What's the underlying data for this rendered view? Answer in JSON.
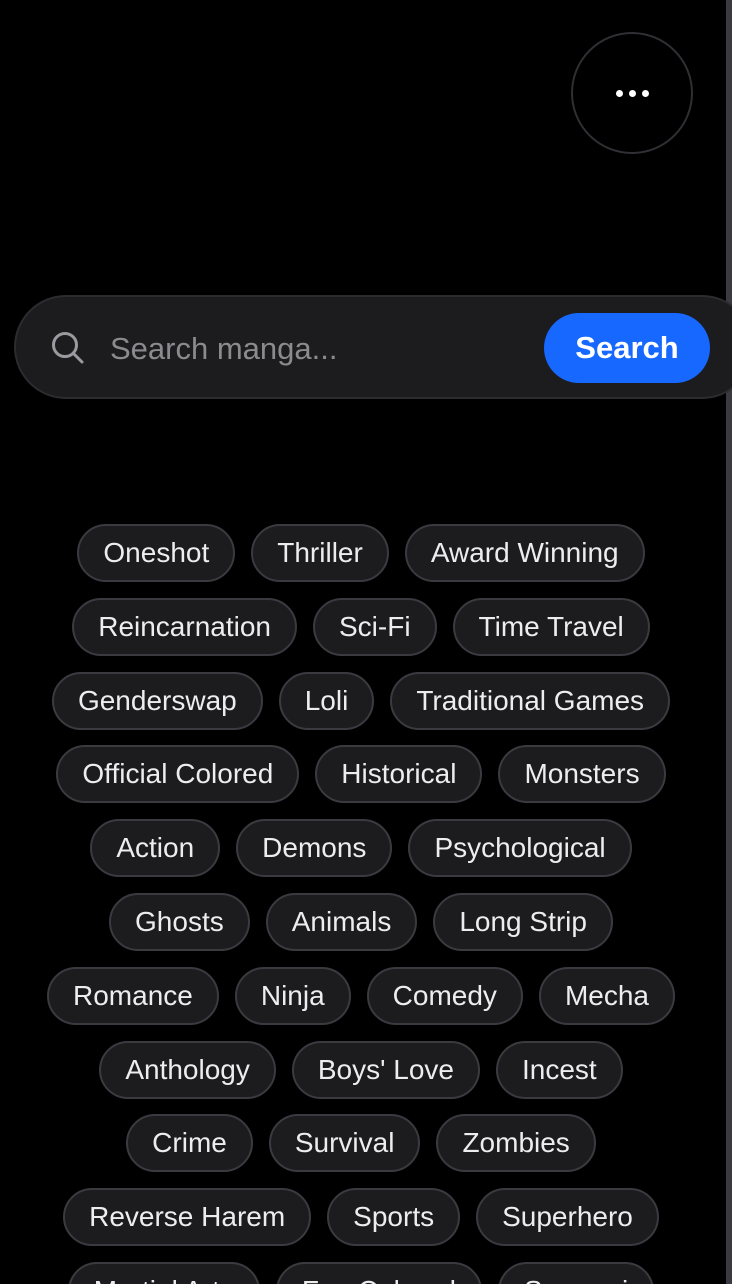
{
  "search": {
    "placeholder": "Search manga...",
    "button_label": "Search"
  },
  "tags": [
    [
      "Oneshot",
      "Thriller",
      "Award Winning"
    ],
    [
      "Reincarnation",
      "Sci-Fi",
      "Time Travel"
    ],
    [
      "Genderswap",
      "Loli",
      "Traditional Games"
    ],
    [
      "Official Colored",
      "Historical",
      "Monsters"
    ],
    [
      "Action",
      "Demons",
      "Psychological"
    ],
    [
      "Ghosts",
      "Animals",
      "Long Strip"
    ],
    [
      "Romance",
      "Ninja",
      "Comedy",
      "Mecha"
    ],
    [
      "Anthology",
      "Boys' Love",
      "Incest"
    ],
    [
      "Crime",
      "Survival",
      "Zombies"
    ],
    [
      "Reverse Harem",
      "Sports",
      "Superhero"
    ],
    [
      "Martial Arts",
      "Fan Colored",
      "Samurai"
    ]
  ],
  "colors": {
    "background": "#000000",
    "accent": "#1668ff",
    "tag_background": "#1c1c1f",
    "tag_border": "#3a3a40"
  }
}
